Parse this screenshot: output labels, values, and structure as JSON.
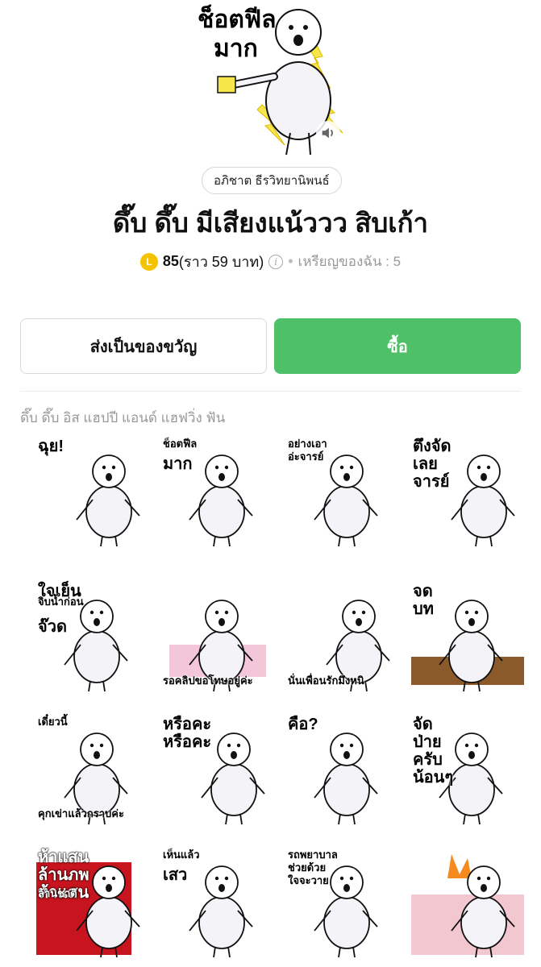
{
  "hero": {
    "caption_line1": "ช็อตฟีล",
    "caption_line2": "มาก",
    "sound_icon": "speaker-icon"
  },
  "author": "อภิชาต ธีรวิทยานิพนธ์",
  "title": "ดึ๊บ ดึ๊บ มีเสียงแน้ววว สิบเก้า",
  "price": {
    "coin_symbol": "L",
    "amount": "85",
    "approx": "(ราว 59 บาท)",
    "info_icon": "i",
    "separator": "•",
    "my_coins": "เหรียญของฉัน : 5"
  },
  "buttons": {
    "gift": "ส่งเป็นของขวัญ",
    "buy": "ซื้อ"
  },
  "colors": {
    "buy_green": "#4dc068",
    "coin_yellow": "#f5c400",
    "muted_text": "#999999"
  },
  "section_title": "ดึ๊บ ดึ๊บ อิส แฮปปี แอนด์ แฮฟวิ่ง ฟัน",
  "stickers": [
    {
      "caption": "ฉุย!"
    },
    {
      "caption": "ช็อตฟีล\nมาก"
    },
    {
      "caption": "อย่างเอา\nอ่ะจารย์"
    },
    {
      "caption": "ตึงจัด\nเลย\nจารย์"
    },
    {
      "caption": "ใจเย็น\nจิบน้ำก่อน\nจ๊วด"
    },
    {
      "caption": "รอคลิปขอโทษอยู่ค่ะ"
    },
    {
      "caption": "นั่นเพื่อนรักมึงหนิ"
    },
    {
      "caption": "จด\nบท"
    },
    {
      "caption": "เดี๋ยวนี้\nคุกเข่าแล้วกราบค่ะ"
    },
    {
      "caption": "หรือคะ\nหรือคะ"
    },
    {
      "caption": "คือ?"
    },
    {
      "caption": "จัด\nป่าย\nครับ\nน้อนๆ"
    },
    {
      "caption": "ห้าแสน\nล้านภพ\nห้าแสน\nล้านชาติ"
    },
    {
      "caption": "เห็นแล้ว\nเสว"
    },
    {
      "caption": "รถพยาบาล\nช่วยด้วย\nใจจะวาย"
    },
    {
      "caption": ""
    }
  ]
}
